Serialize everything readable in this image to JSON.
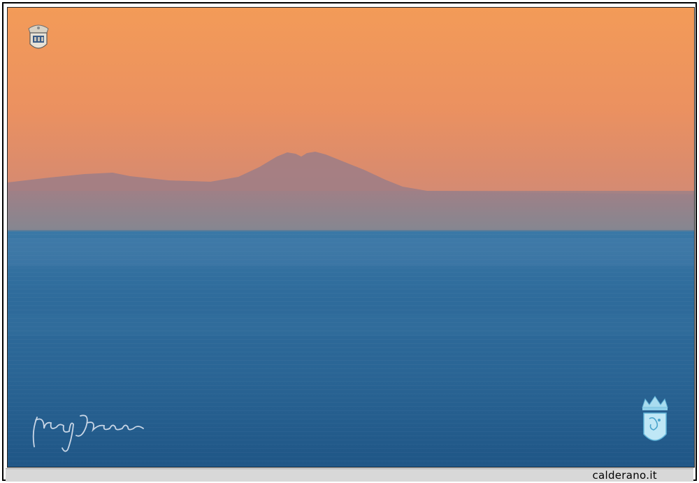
{
  "photo": {
    "subject": "sunset-sea-island-silhouette",
    "colors": {
      "sky_top": "#f29a5a",
      "sky_mid": "#e38a66",
      "sky_haze": "#c98b7e",
      "mountain": "#9c7c86",
      "haze_band": "#7e8692",
      "sea_top": "#3f7aa8",
      "sea_bottom": "#1f5888"
    }
  },
  "footer": {
    "site": "calderano.it",
    "bar_color": "#d8d8d8"
  },
  "watermarks": {
    "top_left": "municipal-emblem",
    "bottom_left": "handwritten-signature",
    "bottom_right": "crowned-crest"
  }
}
